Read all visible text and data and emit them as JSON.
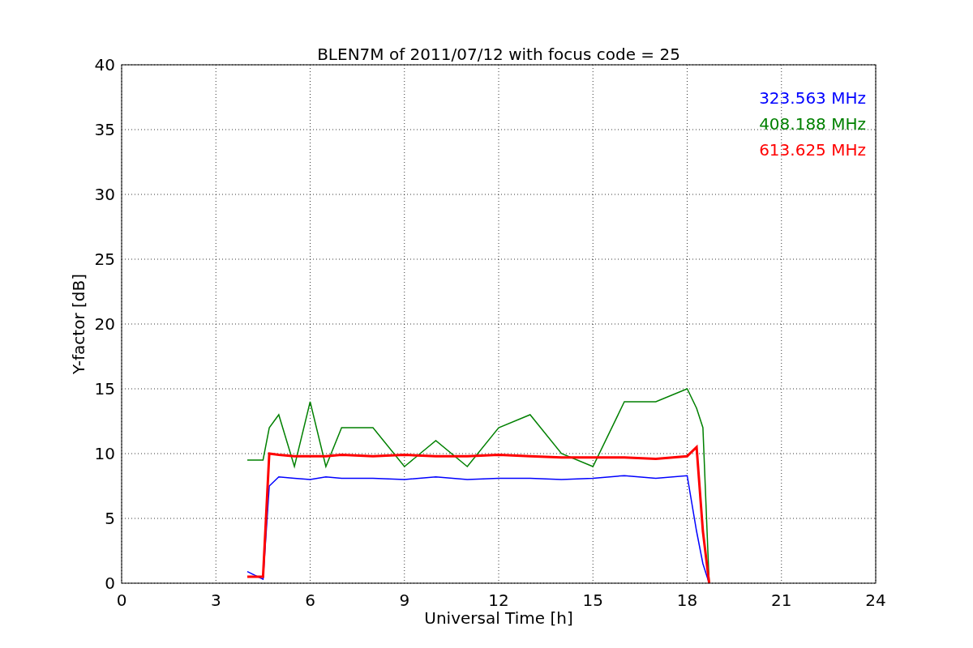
{
  "chart_data": {
    "type": "line",
    "title": "BLEN7M of 2011/07/12 with focus code = 25",
    "xlabel": "Universal Time [h]",
    "ylabel": "Y-factor [dB]",
    "xlim": [
      0,
      24
    ],
    "ylim": [
      0,
      40
    ],
    "xticks": [
      0,
      3,
      6,
      9,
      12,
      15,
      18,
      21,
      24
    ],
    "yticks": [
      0,
      5,
      10,
      15,
      20,
      25,
      30,
      35,
      40
    ],
    "grid": true,
    "x": [
      4,
      4.5,
      4.7,
      5,
      5.5,
      6,
      6.5,
      7,
      8,
      9,
      10,
      11,
      12,
      13,
      14,
      15,
      16,
      17,
      18,
      18.3,
      18.5,
      18.7
    ],
    "series": [
      {
        "name": "323.563 MHz",
        "color": "#0000ff",
        "values": [
          0.9,
          0.3,
          7.5,
          8.2,
          8.1,
          8.0,
          8.2,
          8.1,
          8.1,
          8.0,
          8.2,
          8.0,
          8.1,
          8.1,
          8.0,
          8.1,
          8.3,
          8.1,
          8.3,
          4,
          1.5,
          0
        ]
      },
      {
        "name": "408.188 MHz",
        "color": "#008000",
        "values": [
          9.5,
          9.5,
          12,
          13,
          9,
          14,
          9,
          12,
          12,
          9,
          11,
          9,
          12,
          13,
          10,
          9,
          14,
          14,
          15,
          13.5,
          12,
          0
        ]
      },
      {
        "name": "613.625 MHz",
        "color": "#ff0000",
        "values": [
          0.5,
          0.5,
          10,
          9.9,
          9.8,
          9.8,
          9.8,
          9.9,
          9.8,
          9.9,
          9.8,
          9.8,
          9.9,
          9.8,
          9.7,
          9.7,
          9.7,
          9.6,
          9.8,
          10.5,
          4,
          0
        ]
      }
    ]
  }
}
